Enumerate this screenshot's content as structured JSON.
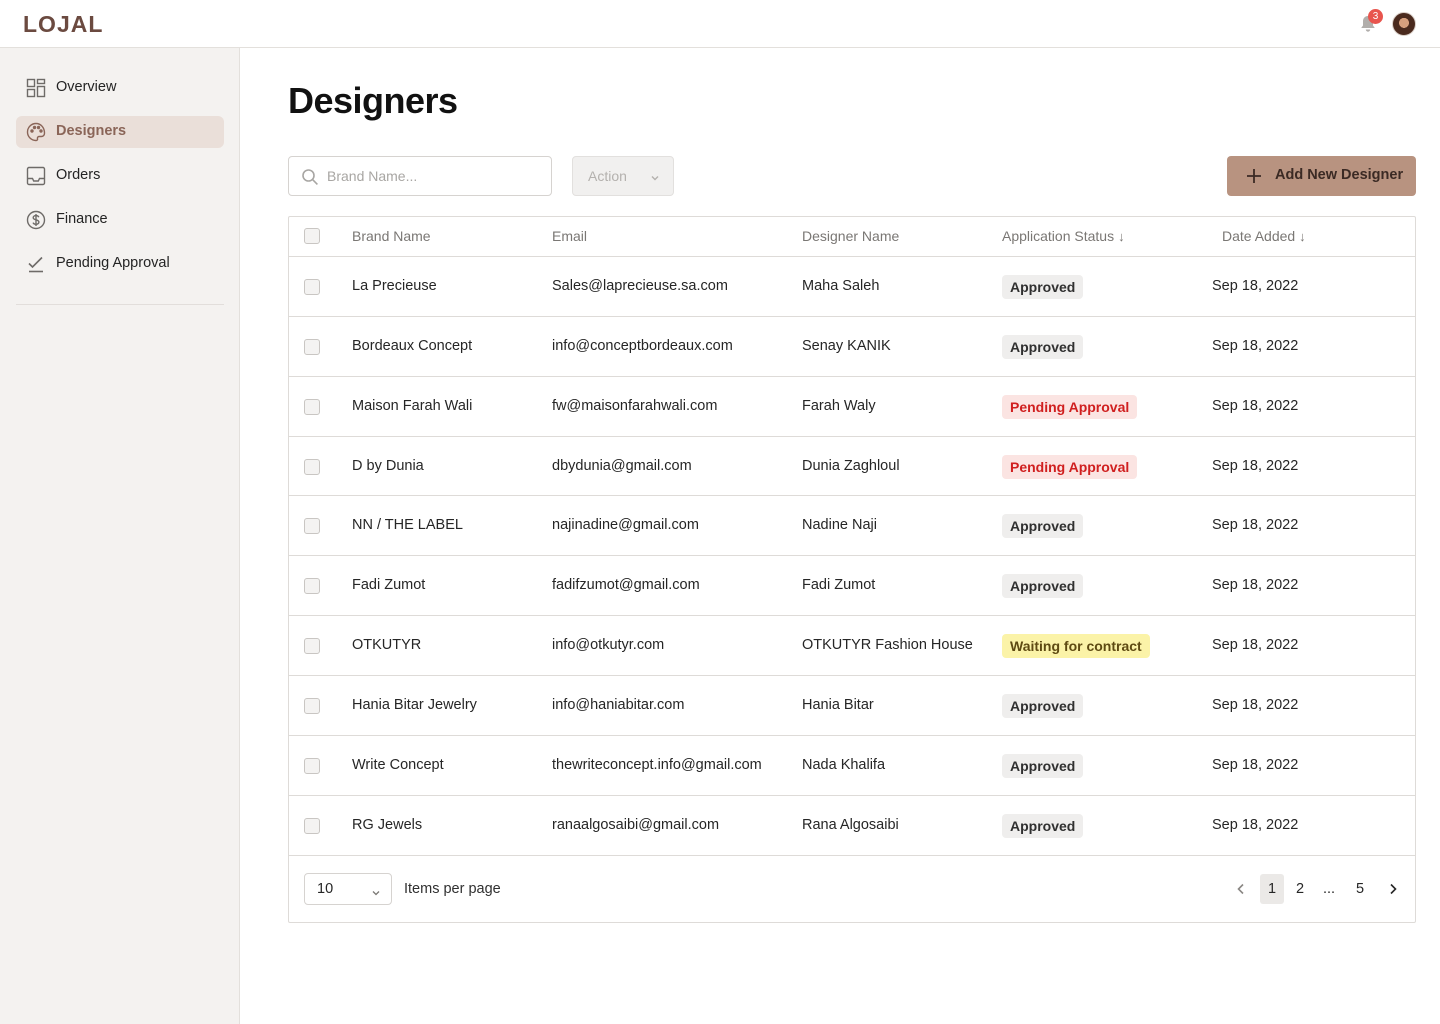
{
  "header": {
    "logo": "LOJAL",
    "notification_count": "3"
  },
  "sidebar": {
    "items": [
      {
        "label": "Overview",
        "icon": "dashboard-icon",
        "active": false
      },
      {
        "label": "Designers",
        "icon": "palette-icon",
        "active": true
      },
      {
        "label": "Orders",
        "icon": "inbox-icon",
        "active": false
      },
      {
        "label": "Finance",
        "icon": "dollar-icon",
        "active": false
      },
      {
        "label": "Pending Approval",
        "icon": "checkmark-icon",
        "active": false
      }
    ]
  },
  "page": {
    "title": "Designers"
  },
  "toolbar": {
    "search_placeholder": "Brand Name...",
    "action_label": "Action",
    "add_button_label": "Add New Designer"
  },
  "table": {
    "columns": [
      "Brand Name",
      "Email",
      "Designer Name",
      "Application Status",
      "Date Added"
    ],
    "sort_arrow": "↓",
    "rows": [
      {
        "brand": "La Precieuse",
        "email": "Sales@laprecieuse.sa.com",
        "designer": "Maha Saleh",
        "status": "Approved",
        "status_type": "approved",
        "date": "Sep 18, 2022"
      },
      {
        "brand": "Bordeaux Concept",
        "email": "info@conceptbordeaux.com",
        "designer": "Senay KANIK",
        "status": "Approved",
        "status_type": "approved",
        "date": "Sep 18, 2022"
      },
      {
        "brand": "Maison Farah Wali",
        "email": "fw@maisonfarahwali.com",
        "designer": "Farah Waly",
        "status": "Pending Approval",
        "status_type": "pending",
        "date": "Sep 18, 2022"
      },
      {
        "brand": "D by Dunia",
        "email": "dbydunia@gmail.com",
        "designer": "Dunia Zaghloul",
        "status": "Pending Approval",
        "status_type": "pending",
        "date": "Sep 18, 2022"
      },
      {
        "brand": "NN / THE LABEL",
        "email": "najinadine@gmail.com",
        "designer": "Nadine Naji",
        "status": "Approved",
        "status_type": "approved",
        "date": "Sep 18, 2022"
      },
      {
        "brand": "Fadi Zumot",
        "email": "fadifzumot@gmail.com",
        "designer": "Fadi Zumot",
        "status": "Approved",
        "status_type": "approved",
        "date": "Sep 18, 2022"
      },
      {
        "brand": "OTKUTYR",
        "email": "info@otkutyr.com",
        "designer": "OTKUTYR Fashion House",
        "status": "Waiting for contract",
        "status_type": "waiting",
        "date": "Sep 18, 2022"
      },
      {
        "brand": "Hania Bitar Jewelry",
        "email": "info@haniabitar.com",
        "designer": "Hania Bitar",
        "status": "Approved",
        "status_type": "approved",
        "date": "Sep 18, 2022"
      },
      {
        "brand": "Write Concept",
        "email": "thewriteconcept.info@gmail.com",
        "designer": "Nada Khalifa",
        "status": "Approved",
        "status_type": "approved",
        "date": "Sep 18, 2022"
      },
      {
        "brand": "RG Jewels",
        "email": "ranaalgosaibi@gmail.com",
        "designer": "Rana Algosaibi",
        "status": "Approved",
        "status_type": "approved",
        "date": "Sep 18, 2022"
      }
    ]
  },
  "pagination": {
    "per_page_value": "10",
    "per_page_label": "Items per page",
    "pages": [
      "1",
      "2",
      "...",
      "5"
    ],
    "current_page": "1"
  },
  "colors": {
    "brand": "#6b4a40",
    "accent_button": "#b89380",
    "active_nav_bg": "#eadfd9",
    "approved_bg": "#efeeed",
    "pending_bg": "#fbe4e2",
    "pending_text": "#d01f1f",
    "waiting_bg": "#fbf3a8",
    "notification_badge": "#e8554e"
  }
}
